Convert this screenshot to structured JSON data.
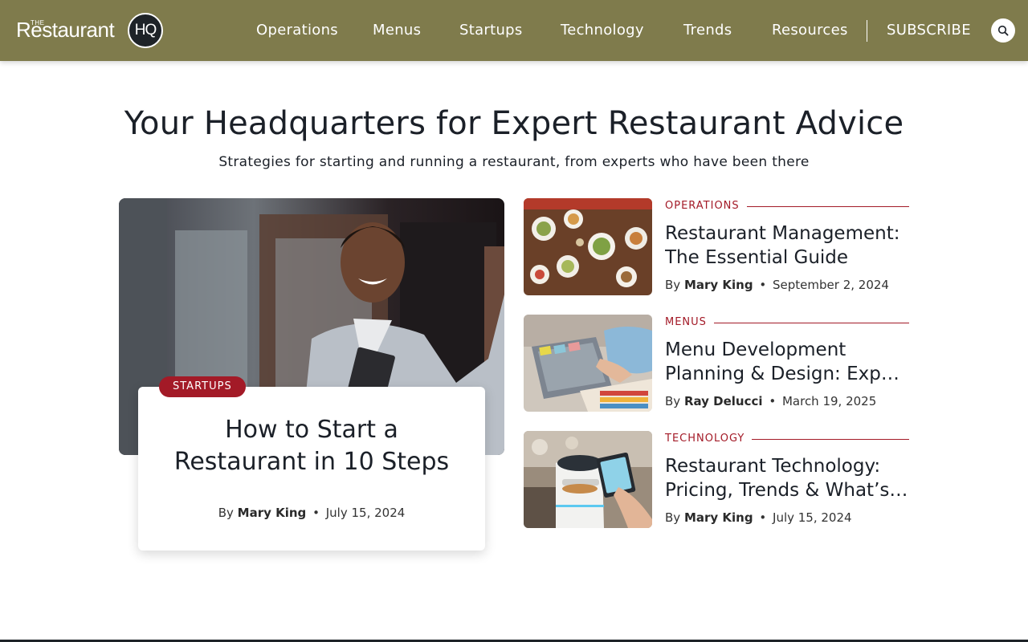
{
  "header": {
    "logo": {
      "the": "THE",
      "word": "Restaurant",
      "badge": "HQ"
    },
    "nav": [
      "Operations",
      "Menus",
      "Startups",
      "Technology",
      "Trends",
      "Resources"
    ],
    "subscribe": "SUBSCRIBE",
    "search_icon": "search-icon",
    "colors": {
      "bar": "#7f7b4c",
      "accent": "#a31a27"
    }
  },
  "hero": {
    "title": "Your Headquarters for Expert Restaurant Advice",
    "subtitle": "Strategies for starting and running a restaurant, from experts who have been there"
  },
  "feature": {
    "tag": "STARTUPS",
    "title_lines": [
      "How to Start a",
      "Restaurant in 10 Steps"
    ],
    "by": "By",
    "author": "Mary King",
    "separator": "•",
    "date": "July 15, 2024",
    "image": "photo of a smiling restaurant owner holding a tablet at a doorway"
  },
  "articles": [
    {
      "category": "OPERATIONS",
      "title_lines": [
        "Restaurant Management:",
        "The Essential Guide"
      ],
      "by": "By",
      "author": "Mary King",
      "separator": "•",
      "date": "September 2, 2024",
      "image": "overhead photo of shared dishes on a dining table"
    },
    {
      "category": "MENUS",
      "title_lines": [
        "Menu Development",
        "Planning & Design: Exper…"
      ],
      "by": "By",
      "author": "Ray Delucci",
      "separator": "•",
      "date": "March 19, 2025",
      "image": "photo of hands working with laptop and color swatches"
    },
    {
      "category": "TECHNOLOGY",
      "title_lines": [
        "Restaurant Technology:",
        "Pricing, Trends & What’s…"
      ],
      "by": "By",
      "author": "Mary King",
      "separator": "•",
      "date": "July 15, 2024",
      "image": "photo of a serving robot and a tablet in a restaurant"
    }
  ]
}
